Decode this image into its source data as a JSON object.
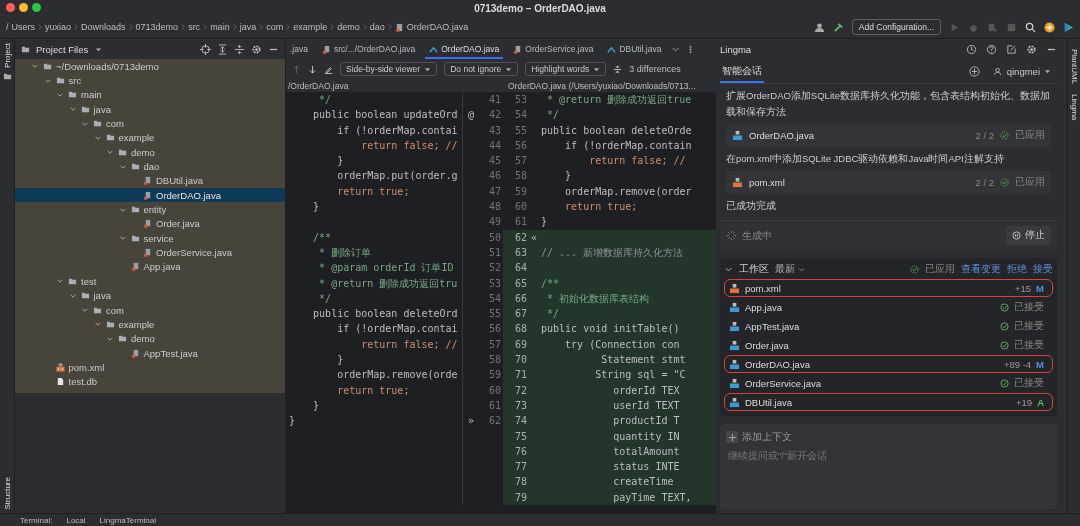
{
  "window": {
    "title": "0713demo – OrderDAO.java"
  },
  "breadcrumb": [
    "/",
    "Users",
    "yuxiao",
    "Downloads",
    "0713demo",
    "src",
    "main",
    "java",
    "com",
    "example",
    "demo",
    "dao",
    "OrderDAO.java"
  ],
  "toolbar": {
    "run_config": "Add Configuration..."
  },
  "left_strip": {
    "top": "Project",
    "bottom": "Structure"
  },
  "right_strip": [
    "PlantUML",
    "Lingma"
  ],
  "project": {
    "title": "Project Files",
    "tree": [
      {
        "label": "~/Downloads/0713demo",
        "kind": "folder",
        "expanded": true,
        "selected": false,
        "children": [
          {
            "label": "src",
            "kind": "folder",
            "expanded": true,
            "selected": false,
            "children": [
              {
                "label": "main",
                "kind": "folder",
                "expanded": true,
                "selected": false,
                "children": [
                  {
                    "label": "java",
                    "kind": "folder",
                    "expanded": true,
                    "selected": false,
                    "children": [
                      {
                        "label": "com",
                        "kind": "folder",
                        "expanded": true,
                        "selected": false,
                        "children": [
                          {
                            "label": "example",
                            "kind": "folder",
                            "expanded": true,
                            "selected": false,
                            "children": [
                              {
                                "label": "demo",
                                "kind": "folder",
                                "expanded": true,
                                "selected": false,
                                "children": [
                                  {
                                    "label": "dao",
                                    "kind": "folder",
                                    "expanded": true,
                                    "selected": false,
                                    "children": [
                                      {
                                        "label": "DBUtil.java",
                                        "kind": "java",
                                        "selected": false
                                      },
                                      {
                                        "label": "OrderDAO.java",
                                        "kind": "java",
                                        "selected": true
                                      }
                                    ]
                                  },
                                  {
                                    "label": "entity",
                                    "kind": "folder",
                                    "expanded": true,
                                    "selected": false,
                                    "children": [
                                      {
                                        "label": "Order.java",
                                        "kind": "java",
                                        "selected": false
                                      }
                                    ]
                                  },
                                  {
                                    "label": "service",
                                    "kind": "folder",
                                    "expanded": true,
                                    "selected": false,
                                    "children": [
                                      {
                                        "label": "OrderService.java",
                                        "kind": "java",
                                        "selected": false
                                      }
                                    ]
                                  },
                                  {
                                    "label": "App.java",
                                    "kind": "java",
                                    "selected": false
                                  }
                                ]
                              }
                            ]
                          }
                        ]
                      }
                    ]
                  }
                ]
              },
              {
                "label": "test",
                "kind": "folder",
                "expanded": true,
                "selected": false,
                "children": [
                  {
                    "label": "java",
                    "kind": "folder",
                    "expanded": true,
                    "selected": false,
                    "children": [
                      {
                        "label": "com",
                        "kind": "folder",
                        "expanded": true,
                        "selected": false,
                        "children": [
                          {
                            "label": "example",
                            "kind": "folder",
                            "expanded": true,
                            "selected": false,
                            "children": [
                              {
                                "label": "demo",
                                "kind": "folder",
                                "expanded": true,
                                "selected": false,
                                "children": [
                                  {
                                    "label": "AppTest.java",
                                    "kind": "java",
                                    "selected": false
                                  }
                                ]
                              }
                            ]
                          }
                        ]
                      }
                    ]
                  }
                ]
              }
            ]
          },
          {
            "label": "pom.xml",
            "kind": "xml",
            "selected": false
          },
          {
            "label": "test.db",
            "kind": "db",
            "selected": false
          }
        ]
      }
    ]
  },
  "editor": {
    "tabs": [
      {
        "label": ".java",
        "kind": "java",
        "selected": false
      },
      {
        "label": "src/.../OrderDAO.java",
        "kind": "java",
        "selected": false
      },
      {
        "label": "OrderDAO.java",
        "kind": "diff",
        "selected": true
      },
      {
        "label": "OrderService.java",
        "kind": "java",
        "selected": false
      },
      {
        "label": "DBUtil.java",
        "kind": "diff",
        "selected": false
      }
    ],
    "viewer": "Side-by-side viewer",
    "ignore": "Do not ignore",
    "highlight": "Highlight words",
    "differences": "3 differences",
    "left_path": "/OrderDAO.java",
    "right_path": "OrderDAO.java (/Users/yuxiao/Downloads/0713...",
    "rows": [
      {
        "left": {
          "no": "41",
          "text": "     */",
          "kind": "doc"
        },
        "right": {
          "no": "53",
          "text": " * @return 删除成功返回true",
          "kind": "doc"
        },
        "added": false
      },
      {
        "left": {
          "no": "42",
          "text": "    public boolean updateOrd",
          "kind": "code"
        },
        "mark": "@",
        "right": {
          "no": "54",
          "text": " */",
          "kind": "doc"
        },
        "added": false
      },
      {
        "left": {
          "no": "43",
          "text": "        if (!orderMap.contai",
          "kind": "code"
        },
        "right": {
          "no": "55",
          "text": "public boolean deleteOrde",
          "kind": "code"
        },
        "added": false
      },
      {
        "left": {
          "no": "44",
          "text": "            return false; //",
          "kind": "keyword"
        },
        "right": {
          "no": "56",
          "text": "    if (!orderMap.contain",
          "kind": "code"
        },
        "added": false
      },
      {
        "left": {
          "no": "45",
          "text": "        }",
          "kind": "code"
        },
        "right": {
          "no": "57",
          "text": "        return false; //",
          "kind": "keyword"
        },
        "added": false
      },
      {
        "left": {
          "no": "46",
          "text": "        orderMap.put(order.g",
          "kind": "code"
        },
        "right": {
          "no": "58",
          "text": "    }",
          "kind": "code"
        },
        "added": false
      },
      {
        "left": {
          "no": "47",
          "text": "        return true;",
          "kind": "keyword"
        },
        "right": {
          "no": "59",
          "text": "    orderMap.remove(order",
          "kind": "code"
        },
        "added": false
      },
      {
        "left": {
          "no": "48",
          "text": "    }",
          "kind": "code"
        },
        "right": {
          "no": "60",
          "text": "    return true;",
          "kind": "keyword"
        },
        "added": false
      },
      {
        "left": {
          "no": "49"
        },
        "right": {
          "no": "61",
          "text": "}",
          "kind": "code"
        },
        "added": false
      },
      {
        "left": {
          "no": "50",
          "text": "    /**",
          "kind": "doc"
        },
        "right": {
          "no": "62",
          "mark": "«"
        },
        "added": true
      },
      {
        "left": {
          "no": "51",
          "text": "     * 删除订单",
          "kind": "doc"
        },
        "right": {
          "no": "63",
          "text": "// ... 新增数据库持久化方法",
          "kind": "comment"
        },
        "added": true
      },
      {
        "left": {
          "no": "52",
          "text": "     * @param orderId 订单ID",
          "kind": "doc"
        },
        "right": {
          "no": "64"
        },
        "added": true
      },
      {
        "left": {
          "no": "53",
          "text": "     * @return 删除成功返回tru",
          "kind": "doc"
        },
        "right": {
          "no": "65",
          "text": "/**",
          "kind": "doc"
        },
        "added": true
      },
      {
        "left": {
          "no": "54",
          "text": "     */",
          "kind": "doc"
        },
        "right": {
          "no": "66",
          "text": " * 初始化数据库表结构",
          "kind": "doc"
        },
        "added": true
      },
      {
        "left": {
          "no": "55",
          "text": "    public boolean deleteOrd",
          "kind": "code"
        },
        "right": {
          "no": "67",
          "text": " */",
          "kind": "doc"
        },
        "added": true
      },
      {
        "left": {
          "no": "56",
          "text": "        if (!orderMap.contai",
          "kind": "code"
        },
        "right": {
          "no": "68",
          "text": "public void initTable()",
          "kind": "code"
        },
        "added": true
      },
      {
        "left": {
          "no": "57",
          "text": "            return false; //",
          "kind": "keyword"
        },
        "right": {
          "no": "69",
          "text": "    try (Connection con",
          "kind": "code"
        },
        "added": true
      },
      {
        "left": {
          "no": "58",
          "text": "        }",
          "kind": "code"
        },
        "right": {
          "no": "70",
          "text": "          Statement stmt",
          "kind": "code"
        },
        "added": true
      },
      {
        "left": {
          "no": "59",
          "text": "        orderMap.remove(orde",
          "kind": "code"
        },
        "right": {
          "no": "71",
          "text": "         String sql = \"C",
          "kind": "code"
        },
        "added": true
      },
      {
        "left": {
          "no": "60",
          "text": "        return true;",
          "kind": "keyword"
        },
        "right": {
          "no": "72",
          "text": "            orderId TEX",
          "kind": "code"
        },
        "added": true
      },
      {
        "left": {
          "no": "61",
          "text": "    }",
          "kind": "code"
        },
        "right": {
          "no": "73",
          "text": "            userId TEXT",
          "kind": "code"
        },
        "added": true
      },
      {
        "left": {
          "no": "62",
          "text": "}",
          "kind": "code"
        },
        "mark": "»",
        "right": {
          "no": "74",
          "text": "            productId T",
          "kind": "code"
        },
        "added": true
      },
      {
        "right": {
          "no": "75",
          "text": "            quantity IN",
          "kind": "code"
        },
        "added": true
      },
      {
        "right": {
          "no": "76",
          "text": "            totalAmount",
          "kind": "code"
        },
        "added": true
      },
      {
        "right": {
          "no": "77",
          "text": "            status INTE",
          "kind": "code"
        },
        "added": true
      },
      {
        "right": {
          "no": "78",
          "text": "            createTime",
          "kind": "code"
        },
        "added": true
      },
      {
        "right": {
          "no": "79",
          "text": "            payTime TEXT,",
          "kind": "code"
        },
        "added": true
      }
    ]
  },
  "lingma": {
    "title": "Lingma",
    "tabs": [
      {
        "label": "智能会话",
        "selected": true
      }
    ],
    "user": "qingmei",
    "messages": [
      {
        "kind": "text",
        "text": "扩展OrderDAO添加SQLite数据库持久化功能，包含表结构初始化、数据加载和保存方法"
      },
      {
        "kind": "file",
        "file": {
          "name": "OrderDAO.java",
          "kind": "java"
        },
        "count": "2 / 2",
        "status": "已应用"
      },
      {
        "kind": "text",
        "text": "在pom.xml中添加SQLite JDBC驱动依赖和Java时间API注解支持"
      },
      {
        "kind": "file",
        "file": {
          "name": "pom.xml",
          "kind": "xml"
        },
        "count": "2 / 2",
        "status": "已应用"
      },
      {
        "kind": "text",
        "text": "已成功完成"
      }
    ],
    "generating": "生成中",
    "stop": "停止",
    "workspace": {
      "title": "工作区",
      "filter": "最新",
      "applied": "已应用",
      "view": "查看变更",
      "reject": "拒绝",
      "accept": "接受",
      "files": [
        {
          "file": {
            "name": "pom.xml",
            "kind": "xml"
          },
          "highlighted": true,
          "kind": "change",
          "stats": "+15",
          "flag": {
            "text": "M",
            "kind": "modified"
          }
        },
        {
          "file": {
            "name": "App.java",
            "kind": "java"
          },
          "highlighted": false,
          "kind": "accepted",
          "status": "已接受"
        },
        {
          "file": {
            "name": "AppTest.java",
            "kind": "java"
          },
          "highlighted": false,
          "kind": "accepted",
          "status": "已接受"
        },
        {
          "file": {
            "name": "Order.java",
            "kind": "java"
          },
          "highlighted": false,
          "kind": "accepted",
          "status": "已接受"
        },
        {
          "file": {
            "name": "OrderDAO.java",
            "kind": "java"
          },
          "highlighted": true,
          "kind": "change",
          "stats": "+89 -4",
          "flag": {
            "text": "M",
            "kind": "modified"
          }
        },
        {
          "file": {
            "name": "OrderService.java",
            "kind": "java"
          },
          "highlighted": false,
          "kind": "accepted",
          "status": "已接受"
        },
        {
          "file": {
            "name": "DBUtil.java",
            "kind": "java"
          },
          "highlighted": true,
          "kind": "change",
          "stats": "+19",
          "flag": {
            "text": "A",
            "kind": "added"
          }
        }
      ]
    },
    "add_context": "添加上下文",
    "input_placeholder": "继续提问或\"/\"新开会话"
  },
  "bottom_tabs": [
    "Terminal:",
    "Local",
    "LingmaTerminal"
  ]
}
